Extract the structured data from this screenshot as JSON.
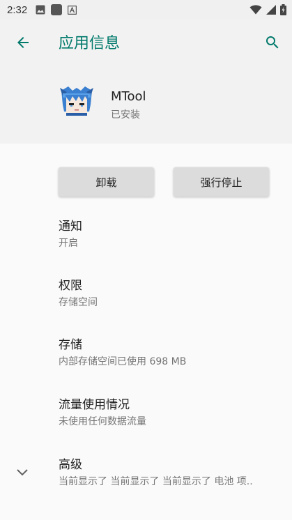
{
  "status_bar": {
    "time": "2:32",
    "left_icons": [
      "image-icon",
      "square-app-icon",
      "a-icon"
    ],
    "right_icons": [
      "wifi-icon",
      "signal-icon",
      "battery-icon"
    ]
  },
  "app_bar": {
    "title": "应用信息",
    "accent_color": "#00796b"
  },
  "app_header": {
    "name": "MTool",
    "status": "已安装"
  },
  "buttons": {
    "uninstall": "卸载",
    "force_stop": "强行停止"
  },
  "preferences": [
    {
      "title": "通知",
      "summary": "开启"
    },
    {
      "title": "权限",
      "summary": "存储空间"
    },
    {
      "title": "存储",
      "summary": "内部存储空间已使用 698 MB"
    },
    {
      "title": "流量使用情况",
      "summary": "未使用任何数据流量"
    },
    {
      "title": "高级",
      "summary": "当前显示了 当前显示了 当前显示了 电池 项.."
    }
  ]
}
